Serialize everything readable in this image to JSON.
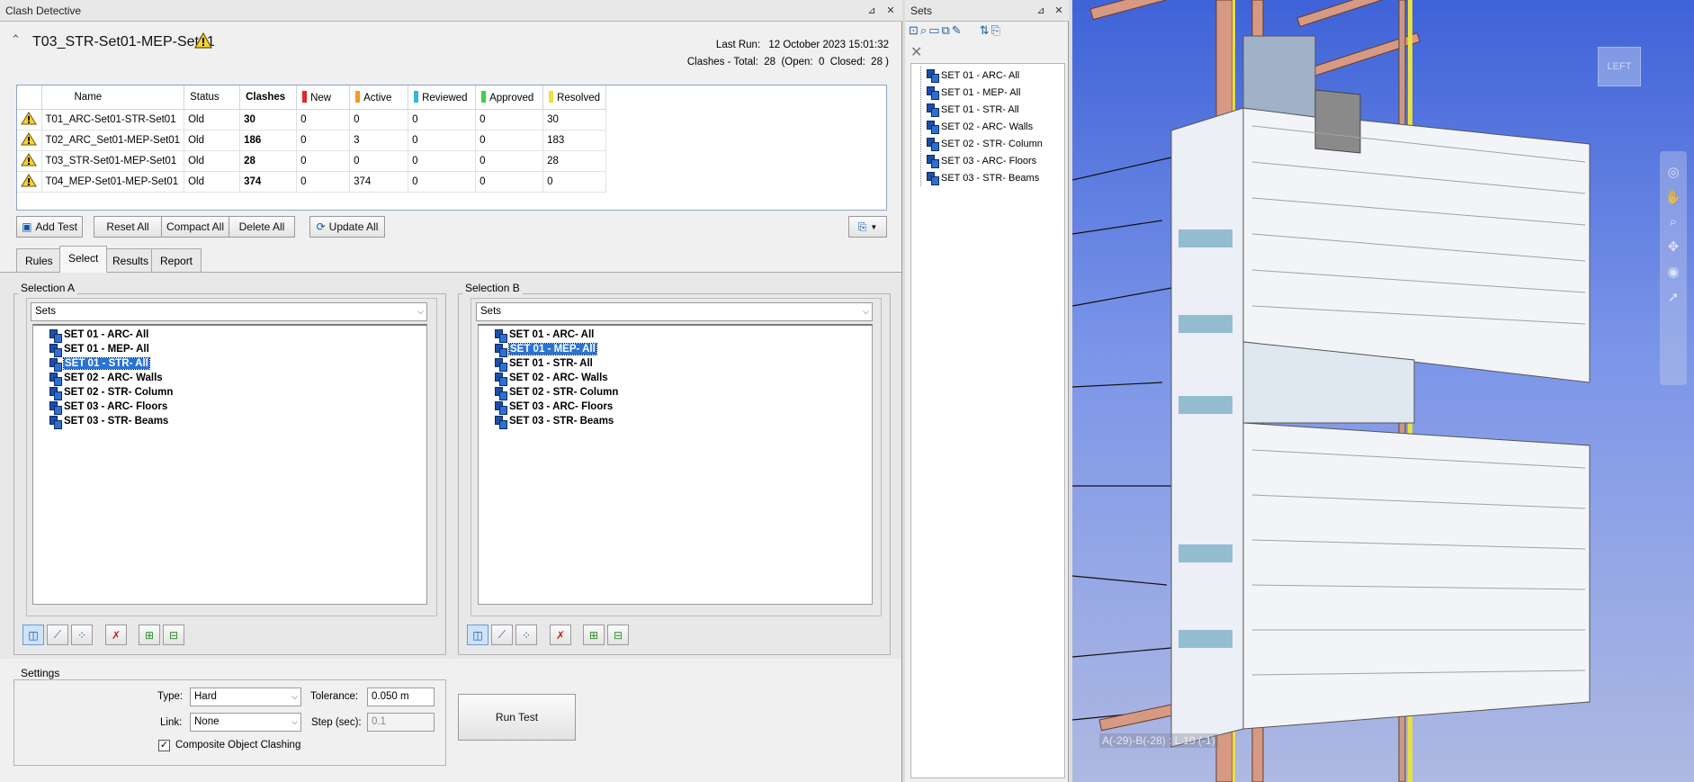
{
  "clash_panel": {
    "title": "Clash Detective",
    "test_name": "T03_STR-Set01-MEP-Set01",
    "last_run_label": "Last Run:",
    "last_run_value": "12 October 2023 15:01:32",
    "clashes_summary": "Clashes - Total:  28  (Open:  0  Closed:  28 )",
    "columns": [
      "Name",
      "Status",
      "Clashes",
      "New",
      "Active",
      "Reviewed",
      "Approved",
      "Resolved"
    ],
    "status_colors": {
      "new": "#e3262b",
      "active": "#f39c1e",
      "reviewed": "#2eb7e6",
      "approved": "#3fd14b",
      "resolved": "#f2e23c"
    },
    "rows": [
      {
        "name": "T01_ARC-Set01-STR-Set01",
        "status": "Old",
        "clashes": "30",
        "new": "0",
        "active": "0",
        "reviewed": "0",
        "approved": "0",
        "resolved": "30"
      },
      {
        "name": "T02_ARC_Set01-MEP-Set01",
        "status": "Old",
        "clashes": "186",
        "new": "0",
        "active": "3",
        "reviewed": "0",
        "approved": "0",
        "resolved": "183"
      },
      {
        "name": "T03_STR-Set01-MEP-Set01",
        "status": "Old",
        "clashes": "28",
        "new": "0",
        "active": "0",
        "reviewed": "0",
        "approved": "0",
        "resolved": "28"
      },
      {
        "name": "T04_MEP-Set01-MEP-Set01",
        "status": "Old",
        "clashes": "374",
        "new": "0",
        "active": "374",
        "reviewed": "0",
        "approved": "0",
        "resolved": "0"
      }
    ],
    "buttons": {
      "add_test": "Add Test",
      "reset_all": "Reset All",
      "compact_all": "Compact All",
      "delete_all": "Delete All",
      "update_all": "Update All"
    },
    "tabs": [
      "Rules",
      "Select",
      "Results",
      "Report"
    ],
    "selection_a": {
      "label": "Selection A",
      "dropdown": "Sets",
      "selected": "SET 01 - STR- All"
    },
    "selection_b": {
      "label": "Selection B",
      "dropdown": "Sets",
      "selected": "SET 01 - MEP- All"
    },
    "set_items": [
      "SET 01 - ARC- All",
      "SET 01 - MEP- All",
      "SET 01 - STR- All",
      "SET 02 - ARC- Walls",
      "SET 02 - STR- Column",
      "SET 03 - ARC- Floors",
      "SET 03 - STR- Beams"
    ],
    "settings": {
      "label": "Settings",
      "type_label": "Type:",
      "type_value": "Hard",
      "tolerance_label": "Tolerance:",
      "tolerance_value": "0.050 m",
      "link_label": "Link:",
      "link_value": "None",
      "step_label": "Step (sec):",
      "step_value": "0.1",
      "composite_label": "Composite Object Clashing",
      "composite_checked": true
    },
    "run_test": "Run Test"
  },
  "sets_panel": {
    "title": "Sets",
    "items": [
      "SET 01 - ARC- All",
      "SET 01 - MEP- All",
      "SET 01 - STR- All",
      "SET 02 - ARC- Walls",
      "SET 02 - STR- Column",
      "SET 03 - ARC- Floors",
      "SET 03 - STR- Beams"
    ]
  },
  "viewport": {
    "viewcube_label": "LEFT",
    "grid_readout": "A(-29)-B(-28) : L 10 (-1)"
  }
}
